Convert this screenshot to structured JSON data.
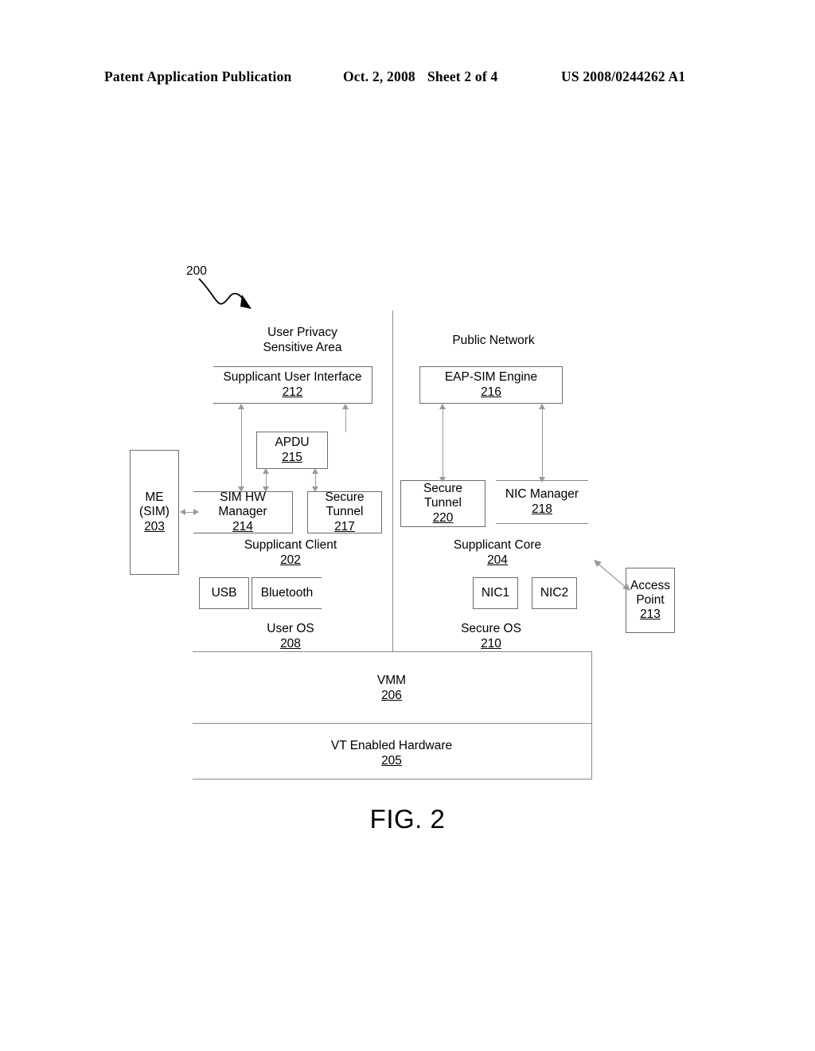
{
  "header": {
    "publication": "Patent Application Publication",
    "date": "Oct. 2, 2008",
    "sheet": "Sheet 2 of 4",
    "number": "US 2008/0244262 A1"
  },
  "figure": {
    "caption": "FIG. 2",
    "callout": "200",
    "zones": {
      "left_zone_label_line1": "User Privacy",
      "left_zone_label_line2": "Sensitive Area",
      "right_zone_label": "Public Network"
    },
    "blocks": [
      {
        "id": "supplicant-user-interface",
        "label": "Supplicant User Interface",
        "ref": "212"
      },
      {
        "id": "eap-sim-engine",
        "label": "EAP-SIM Engine",
        "ref": "216"
      },
      {
        "id": "apdu",
        "label": "APDU",
        "ref": "215"
      },
      {
        "id": "me-sim",
        "label_line1": "ME",
        "label_line2": "(SIM)",
        "ref": "203"
      },
      {
        "id": "sim-hw-manager",
        "label_line1": "SIM HW",
        "label_line2": "Manager",
        "ref": "214"
      },
      {
        "id": "secure-tunnel-217",
        "label_line1": "Secure",
        "label_line2": "Tunnel",
        "ref": "217"
      },
      {
        "id": "secure-tunnel-220",
        "label_line1": "Secure",
        "label_line2": "Tunnel",
        "ref": "220"
      },
      {
        "id": "nic-manager",
        "label": "NIC Manager",
        "ref": "218"
      },
      {
        "id": "supplicant-client",
        "label": "Supplicant Client",
        "ref": "202"
      },
      {
        "id": "supplicant-core",
        "label": "Supplicant Core",
        "ref": "204"
      },
      {
        "id": "usb",
        "label": "USB",
        "ref": ""
      },
      {
        "id": "bluetooth",
        "label": "Bluetooth",
        "ref": ""
      },
      {
        "id": "nic1",
        "label": "NIC1",
        "ref": ""
      },
      {
        "id": "nic2",
        "label": "NIC2",
        "ref": ""
      },
      {
        "id": "user-os",
        "label": "User OS",
        "ref": "208"
      },
      {
        "id": "secure-os",
        "label": "Secure OS",
        "ref": "210"
      },
      {
        "id": "vmm",
        "label": "VMM",
        "ref": "206"
      },
      {
        "id": "vt-enabled-hardware",
        "label": "VT Enabled Hardware",
        "ref": "205"
      },
      {
        "id": "access-point",
        "label_line1": "Access",
        "label_line2": "Point",
        "ref": "213"
      }
    ],
    "colors": {
      "ink": "#000000",
      "rule": "#8a8a8a",
      "connector": "#9a9a9a",
      "background": "#ffffff"
    }
  }
}
